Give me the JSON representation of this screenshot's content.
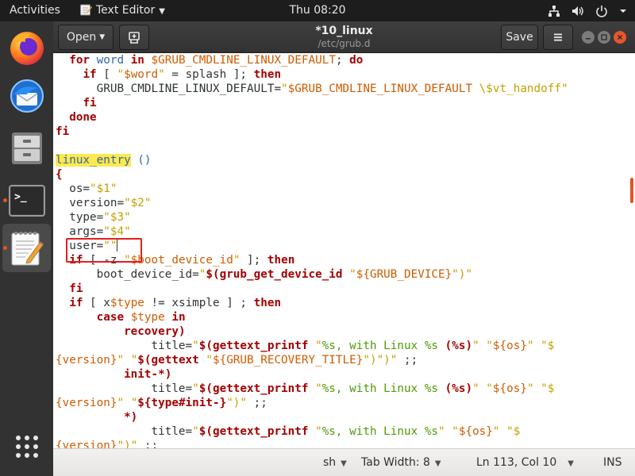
{
  "topbar": {
    "activities": "Activities",
    "app_name": "Text Editor",
    "clock": "Thu 08:20",
    "icons": [
      "network-icon",
      "volume-icon",
      "power-icon",
      "chevron-down-icon"
    ]
  },
  "dock": {
    "items": [
      {
        "name": "firefox",
        "icon": "firefox-icon"
      },
      {
        "name": "thunderbird",
        "icon": "thunderbird-icon"
      },
      {
        "name": "files",
        "icon": "file-cabinet-icon"
      },
      {
        "name": "terminal",
        "icon": "terminal-icon",
        "prompt": ">_"
      },
      {
        "name": "text-editor",
        "icon": "text-editor-icon",
        "active": true
      }
    ],
    "apps_grid_icon": "grid-icon"
  },
  "header": {
    "open_label": "Open",
    "title": "*10_linux",
    "path": "/etc/grub.d",
    "save_label": "Save"
  },
  "editor": {
    "lines": [
      [
        [
          "  ",
          ""
        ],
        [
          "for",
          "kw"
        ],
        [
          " word ",
          "pr"
        ],
        [
          "in",
          "kw"
        ],
        [
          " ",
          ""
        ],
        [
          "$GRUB_CMDLINE_LINUX_DEFAULT",
          "vr"
        ],
        [
          "; ",
          ""
        ],
        [
          "do",
          "kw"
        ]
      ],
      [
        [
          "    ",
          ""
        ],
        [
          "if",
          "kw"
        ],
        [
          " [ ",
          ""
        ],
        [
          "\"",
          "st"
        ],
        [
          "$word",
          "vr"
        ],
        [
          "\"",
          "st"
        ],
        [
          " = splash ]; ",
          ""
        ],
        [
          "then",
          "kw"
        ]
      ],
      [
        [
          "      GRUB_CMDLINE_LINUX_DEFAULT=",
          ""
        ],
        [
          "\"",
          "st"
        ],
        [
          "$GRUB_CMDLINE_LINUX_DEFAULT",
          "vr"
        ],
        [
          " \\$vt_handoff\"",
          "st"
        ]
      ],
      [
        [
          "    ",
          ""
        ],
        [
          "fi",
          "kw"
        ]
      ],
      [
        [
          "  ",
          ""
        ],
        [
          "done",
          "kw"
        ]
      ],
      [
        [
          "fi",
          "kw"
        ]
      ],
      [
        [
          "",
          ""
        ]
      ],
      [
        [
          "linux_entry",
          "fn"
        ],
        [
          " ()",
          "pr"
        ]
      ],
      [
        [
          "{",
          "kw"
        ]
      ],
      [
        [
          "  os=",
          ""
        ],
        [
          "\"$1\"",
          "st"
        ]
      ],
      [
        [
          "  version=",
          ""
        ],
        [
          "\"$2\"",
          "st"
        ]
      ],
      [
        [
          "  type=",
          ""
        ],
        [
          "\"$3\"",
          "st"
        ]
      ],
      [
        [
          "  args=",
          ""
        ],
        [
          "\"$4\"",
          "st"
        ]
      ],
      [
        [
          "  user=",
          ""
        ],
        [
          "\"\"",
          "st"
        ],
        [
          "|",
          "cursor"
        ]
      ],
      [
        [
          "  ",
          ""
        ],
        [
          "if",
          "kw"
        ],
        [
          " [ -z ",
          ""
        ],
        [
          "\"",
          "st"
        ],
        [
          "$boot_device_id",
          "vr"
        ],
        [
          "\"",
          "st"
        ],
        [
          " ]; ",
          ""
        ],
        [
          "then",
          "kw"
        ]
      ],
      [
        [
          "      boot_device_id=",
          ""
        ],
        [
          "\"",
          "st"
        ],
        [
          "$(grub_get_device_id ",
          "ss"
        ],
        [
          "\"",
          "st"
        ],
        [
          "${GRUB_DEVICE}",
          "vr"
        ],
        [
          "\")\"",
          "st"
        ]
      ],
      [
        [
          "  ",
          ""
        ],
        [
          "fi",
          "kw"
        ]
      ],
      [
        [
          "  ",
          ""
        ],
        [
          "if",
          "kw"
        ],
        [
          " [ x",
          ""
        ],
        [
          "$type",
          "vr"
        ],
        [
          " != xsimple ] ; ",
          ""
        ],
        [
          "then",
          "kw"
        ]
      ],
      [
        [
          "      ",
          ""
        ],
        [
          "case",
          "kw"
        ],
        [
          " ",
          ""
        ],
        [
          "$type",
          "vr"
        ],
        [
          " ",
          ""
        ],
        [
          "in",
          "kw"
        ]
      ],
      [
        [
          "          ",
          ""
        ],
        [
          "recovery)",
          "kw"
        ]
      ],
      [
        [
          "              title=",
          ""
        ],
        [
          "\"",
          "st"
        ],
        [
          "$(gettext_printf ",
          "ss"
        ],
        [
          "\"",
          "st"
        ],
        [
          "%s, with Linux %s ",
          "ps"
        ],
        [
          "(%s)",
          "ss"
        ],
        [
          "\"",
          "st"
        ],
        [
          " ",
          ""
        ],
        [
          "\"",
          "st"
        ],
        [
          "${os}",
          "vr"
        ],
        [
          "\"",
          "st"
        ],
        [
          " ",
          ""
        ],
        [
          "\"$",
          "st"
        ]
      ],
      [
        [
          "{version}",
          "vr"
        ],
        [
          "\"",
          "st"
        ],
        [
          " ",
          ""
        ],
        [
          "\"",
          "st"
        ],
        [
          "$(gettext ",
          "ss"
        ],
        [
          "\"",
          "st"
        ],
        [
          "${GRUB_RECOVERY_TITLE}",
          "vr"
        ],
        [
          "\")\")\"",
          "st"
        ],
        [
          " ;;",
          ""
        ]
      ],
      [
        [
          "          ",
          ""
        ],
        [
          "init-*)",
          "kw"
        ]
      ],
      [
        [
          "              title=",
          ""
        ],
        [
          "\"",
          "st"
        ],
        [
          "$(gettext_printf ",
          "ss"
        ],
        [
          "\"",
          "st"
        ],
        [
          "%s, with Linux %s ",
          "ps"
        ],
        [
          "(%s)",
          "ss"
        ],
        [
          "\"",
          "st"
        ],
        [
          " ",
          ""
        ],
        [
          "\"",
          "st"
        ],
        [
          "${os}",
          "vr"
        ],
        [
          "\"",
          "st"
        ],
        [
          " ",
          ""
        ],
        [
          "\"$",
          "st"
        ]
      ],
      [
        [
          "{version}",
          "vr"
        ],
        [
          "\"",
          "st"
        ],
        [
          " ",
          ""
        ],
        [
          "\"",
          "st"
        ],
        [
          "${type#init-}",
          "ss"
        ],
        [
          "\")\"",
          "st"
        ],
        [
          " ;;",
          ""
        ]
      ],
      [
        [
          "          ",
          ""
        ],
        [
          "*)",
          "kw"
        ]
      ],
      [
        [
          "              title=",
          ""
        ],
        [
          "\"",
          "st"
        ],
        [
          "$(gettext_printf ",
          "ss"
        ],
        [
          "\"",
          "st"
        ],
        [
          "%s, with Linux %s",
          "ps"
        ],
        [
          "\"",
          "st"
        ],
        [
          " ",
          ""
        ],
        [
          "\"",
          "st"
        ],
        [
          "${os}",
          "vr"
        ],
        [
          "\"",
          "st"
        ],
        [
          " ",
          ""
        ],
        [
          "\"$",
          "st"
        ]
      ],
      [
        [
          "{version}",
          "vr"
        ],
        [
          "\")\"",
          "st"
        ],
        [
          " ;;",
          ""
        ]
      ]
    ]
  },
  "statusbar": {
    "language": "sh",
    "tab_width": "Tab Width: 8",
    "position": "Ln 113, Col 10",
    "mode": "INS"
  },
  "colors": {
    "accent": "#e95420",
    "highlight_box": "#e0201c",
    "function_highlight": "#fce94f"
  }
}
